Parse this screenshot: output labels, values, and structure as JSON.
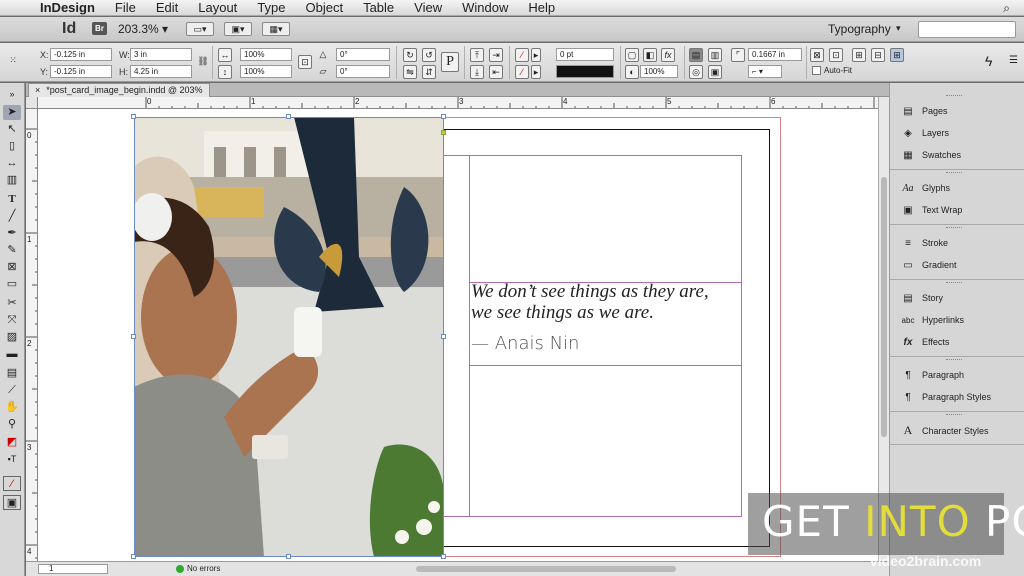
{
  "menubar": {
    "apple_icon": "apple-icon",
    "items": [
      "InDesign",
      "File",
      "Edit",
      "Layout",
      "Type",
      "Object",
      "Table",
      "View",
      "Window",
      "Help"
    ]
  },
  "appbar": {
    "logo": "Id",
    "bridge_label": "Br",
    "zoom": "203.3%",
    "workspace": "Typography"
  },
  "control": {
    "x_label": "X:",
    "x_value": "-0.125 in",
    "y_label": "Y:",
    "y_value": "-0.125 in",
    "w_label": "W:",
    "w_value": "3 in",
    "h_label": "H:",
    "h_value": "4.25 in",
    "scale_x": "100%",
    "scale_y": "100%",
    "rotate": "0°",
    "shear": "0°",
    "stroke_weight": "0 pt",
    "opacity": "100%",
    "offset": "0.1667 in",
    "autofit_label": "Auto-Fit"
  },
  "doc": {
    "tab_title": "*post_card_image_begin.indd @ 203%",
    "close_glyph": "×"
  },
  "ruler": {
    "h_labels": [
      "0",
      "1",
      "2",
      "3",
      "4",
      "5",
      "6"
    ],
    "v_labels": [
      "0",
      "1",
      "2",
      "3",
      "4"
    ]
  },
  "content": {
    "quote_line1": "We don’t see things as they are,",
    "quote_line2": "we see things as we are.",
    "author": "— Anais Nin"
  },
  "statusbar": {
    "page": "1",
    "status": "No errors"
  },
  "panels": {
    "groups": [
      [
        {
          "label": "Pages",
          "icon": "pages-icon",
          "glyph": "▤"
        },
        {
          "label": "Layers",
          "icon": "layers-icon",
          "glyph": "◈"
        },
        {
          "label": "Swatches",
          "icon": "swatches-icon",
          "glyph": "▦"
        }
      ],
      [
        {
          "label": "Glyphs",
          "icon": "glyphs-icon",
          "glyph": "Aa"
        },
        {
          "label": "Text Wrap",
          "icon": "text-wrap-icon",
          "glyph": "▣"
        }
      ],
      [
        {
          "label": "Stroke",
          "icon": "stroke-icon",
          "glyph": "≡"
        },
        {
          "label": "Gradient",
          "icon": "gradient-icon",
          "glyph": "▭"
        }
      ],
      [
        {
          "label": "Story",
          "icon": "story-icon",
          "glyph": "▤"
        },
        {
          "label": "Hyperlinks",
          "icon": "hyperlinks-icon",
          "glyph": "abc"
        },
        {
          "label": "Effects",
          "icon": "effects-icon",
          "glyph": "fx"
        }
      ],
      [
        {
          "label": "Paragraph",
          "icon": "paragraph-icon",
          "glyph": "¶"
        },
        {
          "label": "Paragraph Styles",
          "icon": "paragraph-styles-icon",
          "glyph": "¶"
        }
      ],
      [
        {
          "label": "Character Styles",
          "icon": "character-styles-icon",
          "glyph": "A"
        }
      ]
    ]
  },
  "watermark": {
    "get": "GET",
    "into": "INTO",
    "pc": "PC",
    "sub": "video2brain.com"
  },
  "colors": {
    "frame_blue": "#6a8bc8",
    "margin_purple": "#b36bb3",
    "status_green": "#2fa82f",
    "watermark_accent": "#e2dd3a"
  }
}
